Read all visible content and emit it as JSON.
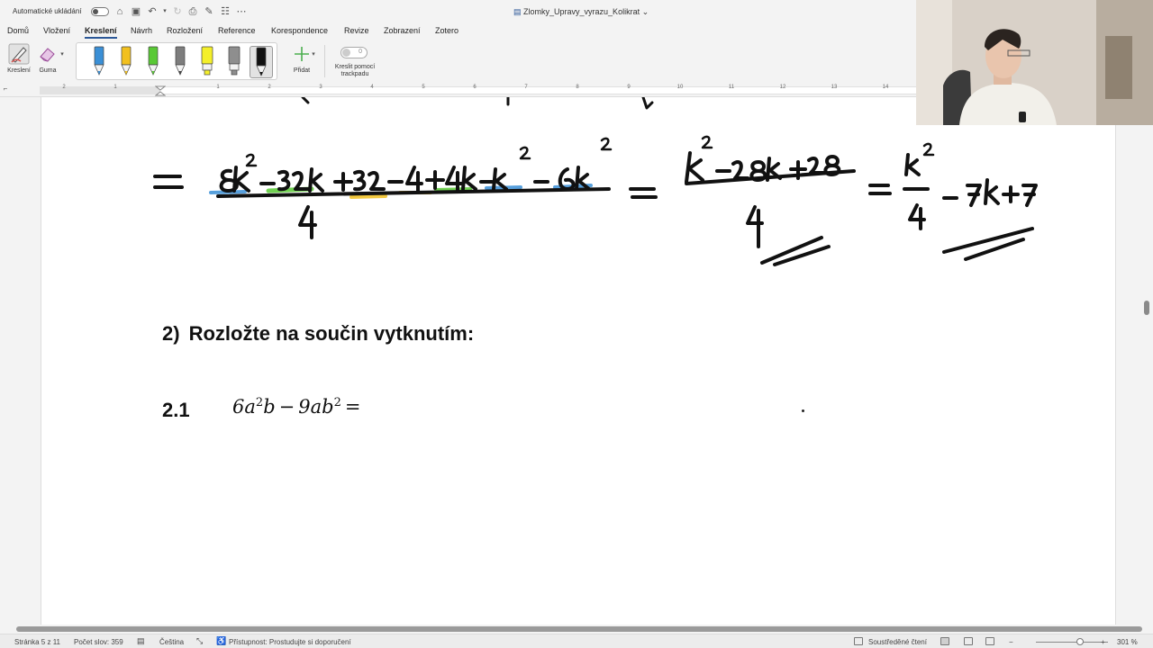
{
  "titlebar": {
    "autosave_label": "Automatické ukládání",
    "document_title": "Zlomky_Upravy_vyrazu_Kolikrat",
    "quick_access_icons": [
      "home-icon",
      "save-icon",
      "undo-icon",
      "redo-icon",
      "print-icon",
      "pen-icon",
      "customize-icon",
      "more-icon"
    ]
  },
  "menu": {
    "tabs": [
      "Domů",
      "Vložení",
      "Kreslení",
      "Návrh",
      "Rozložení",
      "Reference",
      "Korespondence",
      "Revize",
      "Zobrazení",
      "Zotero"
    ],
    "active_tab": "Kreslení"
  },
  "ribbon": {
    "draw_label": "Kreslení",
    "eraser_label": "Guma",
    "add_label": "Přidat",
    "trackpad_label": "Kreslit pomocí trackpadu",
    "trackpad_value": "0",
    "pens": [
      {
        "name": "blue-pen",
        "color": "#3a8fd6"
      },
      {
        "name": "yellow-pen",
        "color": "#f2c01e"
      },
      {
        "name": "green-pen",
        "color": "#59c935"
      },
      {
        "name": "gray-pen",
        "color": "#7d7d7d"
      },
      {
        "name": "yellow-highlighter",
        "color": "#f4ef2a"
      },
      {
        "name": "gray-highlighter",
        "color": "#8e8e8e"
      },
      {
        "name": "black-pen",
        "color": "#111111",
        "selected": true
      }
    ]
  },
  "ruler": {
    "numbers": [
      "2",
      "1",
      "1",
      "2",
      "3",
      "4",
      "5",
      "6",
      "7",
      "8",
      "9",
      "10",
      "11",
      "12",
      "13",
      "14"
    ]
  },
  "document": {
    "handwriting": {
      "line1": "= (8k² − 32k + 32 − 4 + 4k − k² − 6k²) / 4 = (k² − 28k + 28) / 4 = k²/4 − 7k + 7",
      "highlight_colors": [
        "#3a8fd6",
        "#59c935",
        "#f2c01e"
      ]
    },
    "section": {
      "number": "2)",
      "title": "Rozložte na součin vytknutím:"
    },
    "exercise": {
      "number": "2.1",
      "c1": "6",
      "v1": "a",
      "e1": "2",
      "v2": "b",
      "op": "−",
      "c2": "9",
      "v3": "ab",
      "e2": "2",
      "eq": "="
    }
  },
  "status": {
    "page": "Stránka 5 z 11",
    "words": "Počet slov: 359",
    "language": "Čeština",
    "accessibility": "Přístupnost: Prostudujte si doporučení",
    "focus": "Soustředěné čtení",
    "zoom": "301 %",
    "zoom_level": 0.56
  }
}
